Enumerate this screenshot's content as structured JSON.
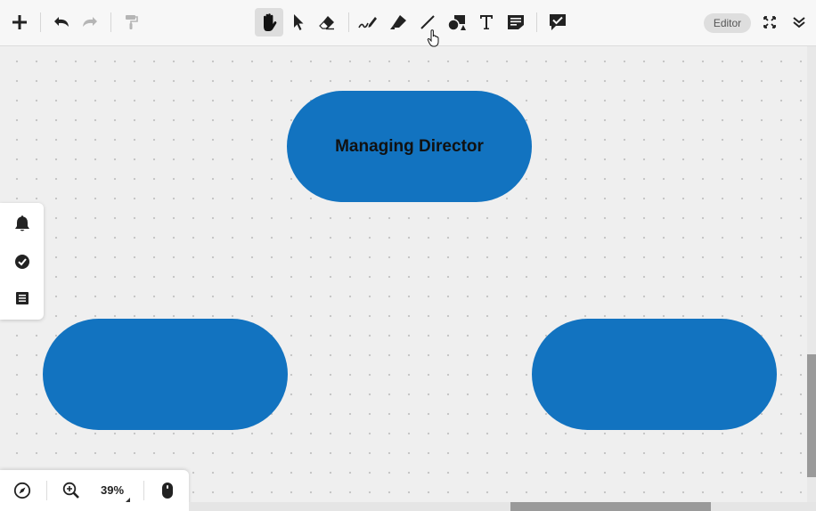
{
  "toolbar": {
    "tools": [
      {
        "icon": "plus-icon",
        "label": "Add"
      },
      {
        "icon": "undo-icon",
        "label": "Undo"
      },
      {
        "icon": "redo-icon",
        "label": "Redo"
      },
      {
        "icon": "format-painter-icon",
        "label": "Format painter"
      },
      {
        "icon": "hand-icon",
        "label": "Pan",
        "active": true
      },
      {
        "icon": "pointer-icon",
        "label": "Select"
      },
      {
        "icon": "eraser-icon",
        "label": "Eraser"
      },
      {
        "icon": "pen-icon",
        "label": "Pen"
      },
      {
        "icon": "highlighter-icon",
        "label": "Highlighter"
      },
      {
        "icon": "line-icon",
        "label": "Line"
      },
      {
        "icon": "shapes-icon",
        "label": "Shapes"
      },
      {
        "icon": "text-icon",
        "label": "Text"
      },
      {
        "icon": "sticky-note-icon",
        "label": "Sticky note"
      },
      {
        "icon": "comment-check-icon",
        "label": "Comment"
      }
    ],
    "editor_badge": "Editor",
    "fullscreen_icon": "fullscreen-icon",
    "collapse_icon": "collapse-chevrons-icon"
  },
  "canvas": {
    "nodes": [
      {
        "label": "Managing Director",
        "color": "#1273c0"
      },
      {
        "label": "",
        "color": "#1273c0"
      },
      {
        "label": "",
        "color": "#1273c0"
      }
    ]
  },
  "side_panel": {
    "items": [
      "bell-icon",
      "check-circle-icon",
      "list-icon"
    ]
  },
  "bottom_panel": {
    "compass_icon": "compass-icon",
    "zoom_icon": "zoom-in-icon",
    "zoom_level": "39%",
    "mouse_icon": "mouse-icon"
  },
  "colors": {
    "accent": "#1273c0",
    "canvas_bg": "#efefef",
    "toolbar_bg": "#f7f7f7"
  }
}
